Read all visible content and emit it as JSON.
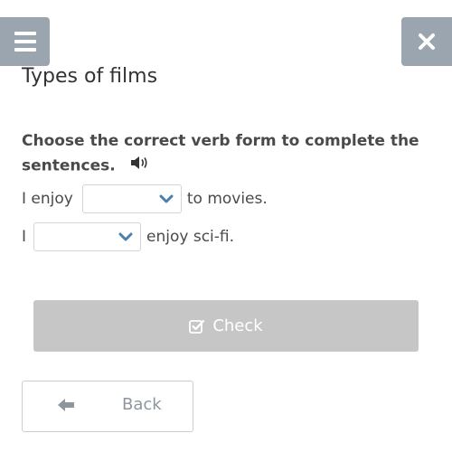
{
  "header": {
    "menu_icon": "hamburger-menu-icon",
    "close_icon": "close-x-icon",
    "button_color": "#9aa5b0"
  },
  "page": {
    "title": "Types of films"
  },
  "exercise": {
    "instruction": "Choose the correct verb form to complete the sentences.",
    "audio_icon": "speaker-icon",
    "sentences": [
      {
        "before": "I enjoy",
        "selected": "",
        "after": "to movies."
      },
      {
        "before": "I",
        "selected": "",
        "after": "enjoy sci-fi."
      }
    ]
  },
  "actions": {
    "check_label": "Check",
    "check_icon": "checkbox-icon",
    "check_color": "#c6c6c6",
    "back_label": "Back",
    "back_icon": "arrow-left-icon"
  }
}
